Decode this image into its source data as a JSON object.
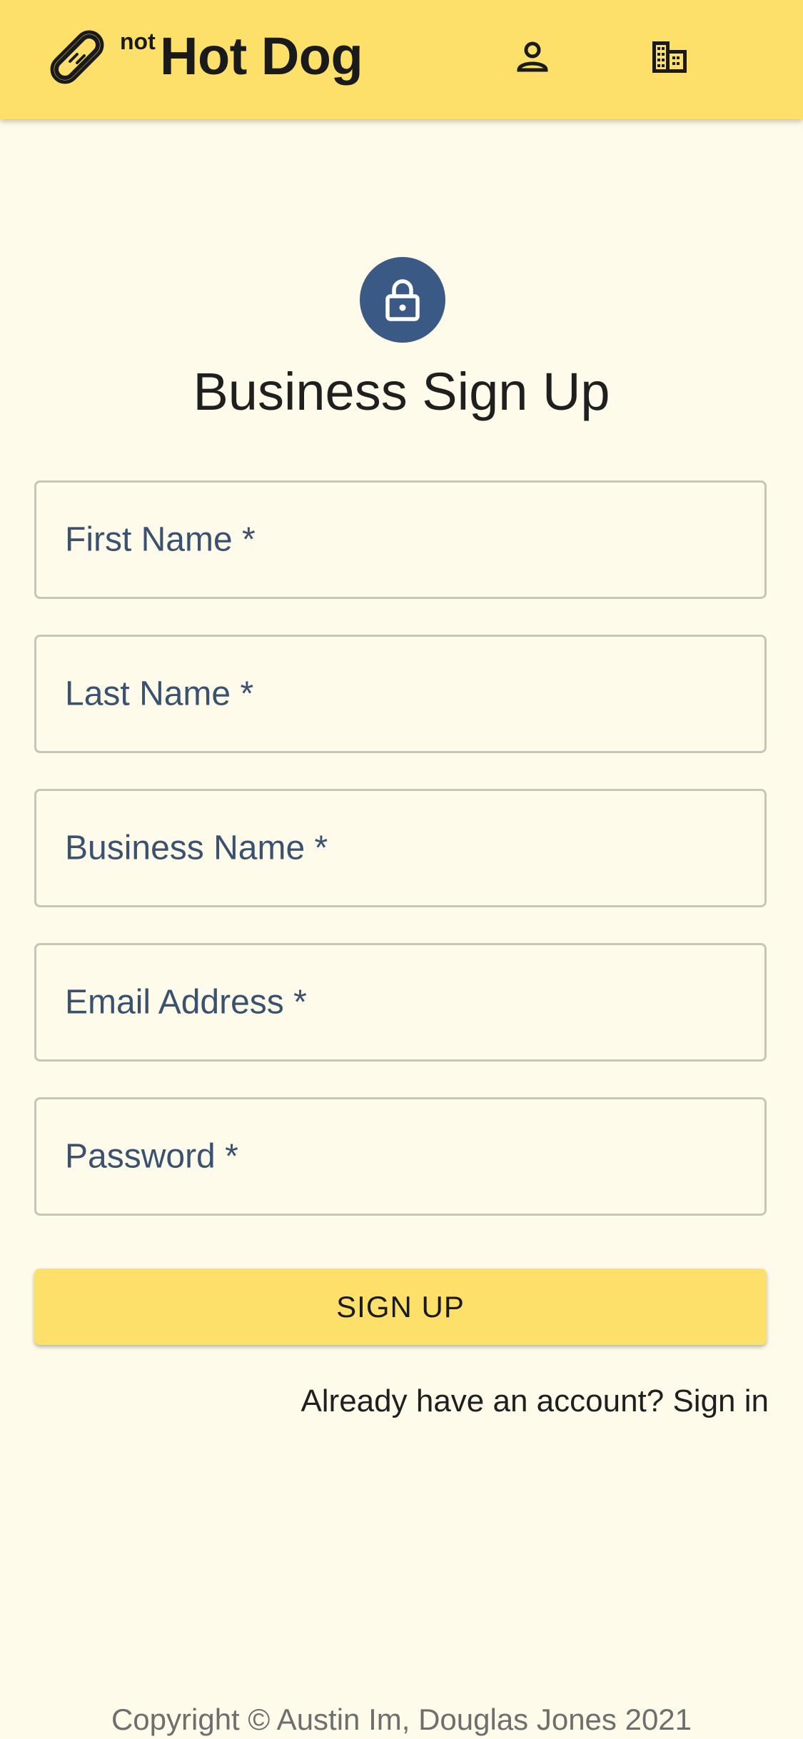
{
  "header": {
    "brand_prefix": "not",
    "brand_title": "Hot Dog",
    "icons": [
      "hotdog-icon",
      "person-icon",
      "business-icon"
    ]
  },
  "form": {
    "lock_icon": "lock-icon",
    "title": "Business Sign Up",
    "fields": [
      {
        "label": "First Name *"
      },
      {
        "label": "Last Name *"
      },
      {
        "label": "Business Name *"
      },
      {
        "label": "Email Address *"
      },
      {
        "label": "Password *"
      }
    ],
    "submit_label": "SIGN UP",
    "signin_link": "Already have an account? Sign in"
  },
  "footer": {
    "copyright": "Copyright © Austin Im, Douglas Jones 2021"
  },
  "colors": {
    "appbar": "#fce06a",
    "background": "#fefbea",
    "avatar": "#3b5985",
    "field_label": "#3a5170"
  }
}
